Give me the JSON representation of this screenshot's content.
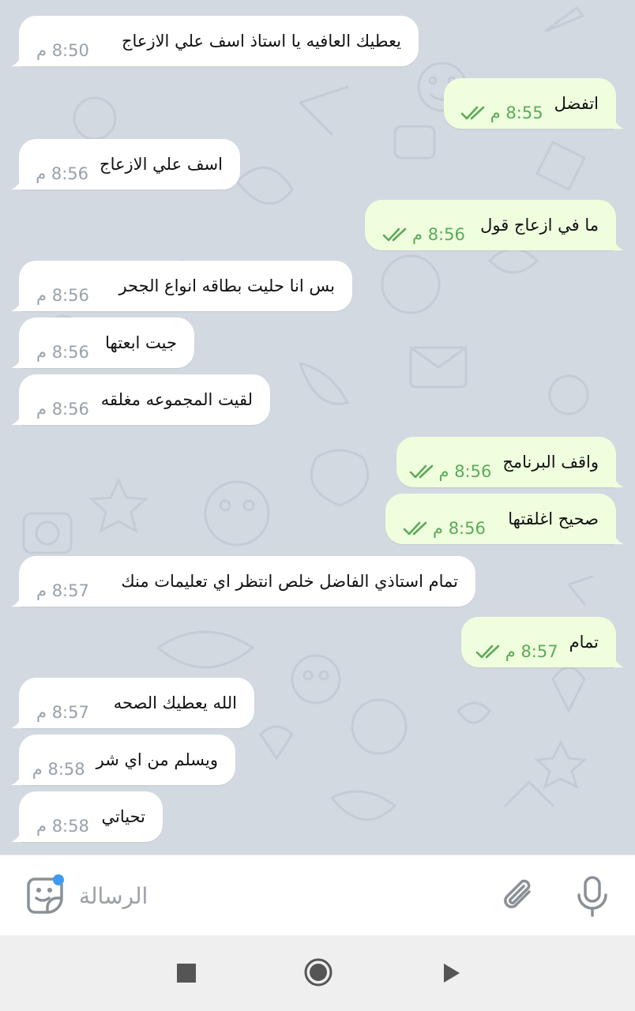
{
  "chat": {
    "messages": [
      {
        "dir": "in",
        "text": "يعطيك العافيه يا استاذ اسف علي الازعاج",
        "time": "8:50 م"
      },
      {
        "dir": "out",
        "text": "اتفضل",
        "time": "8:55 م",
        "read": true
      },
      {
        "dir": "in",
        "text": "اسف علي الازعاج",
        "time": "8:56 م"
      },
      {
        "dir": "out",
        "text": "ما في ازعاج قول",
        "time": "8:56 م",
        "read": true
      },
      {
        "dir": "in",
        "text": "بس انا حليت بطاقه انواع الجحر",
        "time": "8:56 م"
      },
      {
        "dir": "in",
        "text": "جيت ابعتها",
        "time": "8:56 م"
      },
      {
        "dir": "in",
        "text": "لقيت المجموعه مغلقه",
        "time": "8:56 م"
      },
      {
        "dir": "out",
        "text": "واقف البرنامج",
        "time": "8:56 م",
        "read": true
      },
      {
        "dir": "out",
        "text": "صحيح اغلقتها",
        "time": "8:56 م",
        "read": true
      },
      {
        "dir": "in",
        "text": "تمام استاذي الفاضل خلص انتظر اي تعليمات منك",
        "time": "8:57 م"
      },
      {
        "dir": "out",
        "text": "تمام",
        "time": "8:57 م",
        "read": true
      },
      {
        "dir": "in",
        "text": "الله  يعطيك الصحه",
        "time": "8:57 م"
      },
      {
        "dir": "in",
        "text": "ويسلم من اي شر",
        "time": "8:58 م"
      },
      {
        "dir": "in",
        "text": "تحياتي",
        "time": "8:58 م"
      }
    ]
  },
  "composer": {
    "placeholder": "الرسالة",
    "sticker_icon": "sticker-icon",
    "attach_icon": "paperclip-icon",
    "mic_icon": "microphone-icon",
    "notification_dot_color": "#3e9bf0"
  },
  "navbar": {
    "back_icon": "square-icon",
    "home_icon": "circle-icon",
    "recents_icon": "triangle-icon"
  },
  "colors": {
    "chat_background": "#d3d9e1",
    "incoming_bubble": "#ffffff",
    "outgoing_bubble": "#efffde",
    "outgoing_time": "#5da95a",
    "incoming_time": "#98a1ab"
  }
}
